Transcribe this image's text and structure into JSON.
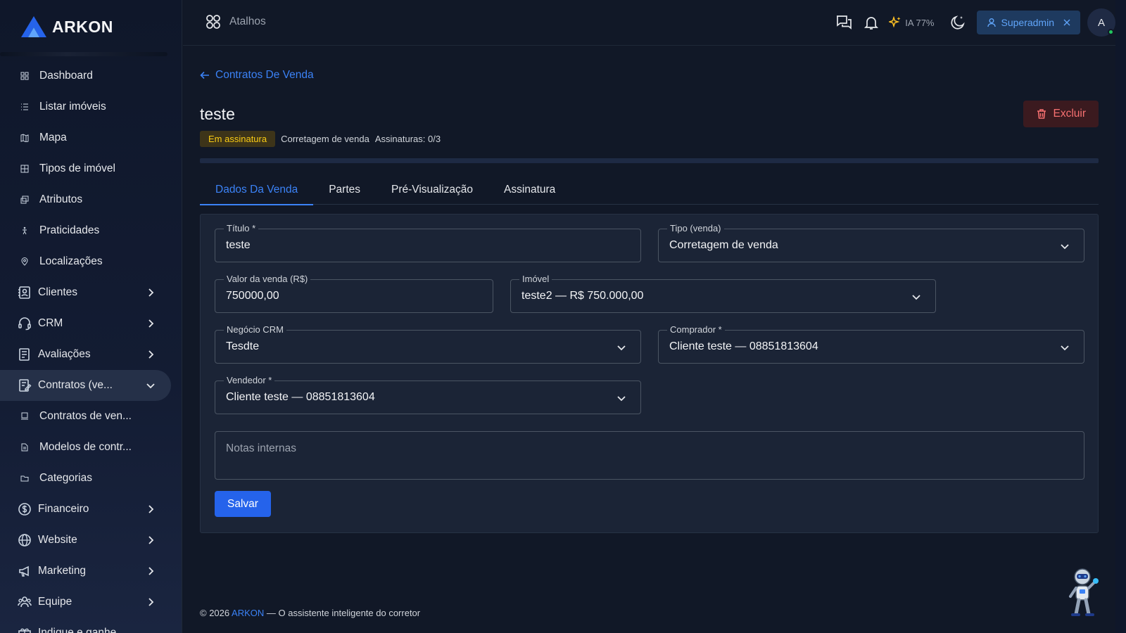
{
  "brand": {
    "name": "ARKON"
  },
  "sidebar": {
    "items": [
      {
        "label": "Dashboard",
        "icon": "dashboard-icon"
      },
      {
        "label": "Listar imóveis",
        "icon": "list-icon"
      },
      {
        "label": "Mapa",
        "icon": "map-icon"
      },
      {
        "label": "Tipos de imóvel",
        "icon": "grid-icon"
      },
      {
        "label": "Atributos",
        "icon": "attributes-icon"
      },
      {
        "label": "Praticidades",
        "icon": "accessibility-icon"
      },
      {
        "label": "Localizações",
        "icon": "location-pin-icon"
      },
      {
        "label": "Clientes",
        "icon": "contacts-icon"
      },
      {
        "label": "CRM",
        "icon": "headset-icon"
      },
      {
        "label": "Avaliações",
        "icon": "document-list-icon"
      },
      {
        "label": "Contratos (ve...",
        "icon": "contract-icon"
      },
      {
        "label": "Contratos de ven...",
        "icon": "monitor-icon"
      },
      {
        "label": "Modelos de contr...",
        "icon": "file-icon"
      },
      {
        "label": "Categorias",
        "icon": "folder-icon"
      },
      {
        "label": "Financeiro",
        "icon": "dollar-circle-icon"
      },
      {
        "label": "Website",
        "icon": "globe-icon"
      },
      {
        "label": "Marketing",
        "icon": "megaphone-icon"
      },
      {
        "label": "Equipe",
        "icon": "team-icon"
      },
      {
        "label": "Indique e ganhe",
        "icon": "gift-icon"
      }
    ]
  },
  "topbar": {
    "shortcuts_label": "Atalhos",
    "ia_label": "IA 77%",
    "role_label": "Superadmin",
    "avatar_initial": "A"
  },
  "main": {
    "back_label": "Contratos De Venda",
    "title": "teste",
    "delete_label": "Excluir",
    "status_badge": "Em assinatura",
    "contract_type": "Corretagem de venda",
    "signatures": "Assinaturas: 0/3",
    "tabs": [
      {
        "label": "Dados Da Venda"
      },
      {
        "label": "Partes"
      },
      {
        "label": "Pré-Visualização"
      },
      {
        "label": "Assinatura"
      }
    ],
    "form": {
      "titulo": {
        "label": "Título *",
        "value": "teste"
      },
      "tipo": {
        "label": "Tipo (venda)",
        "value": "Corretagem de venda"
      },
      "valor": {
        "label": "Valor da venda (R$)",
        "value": "750000,00"
      },
      "imovel": {
        "label": "Imóvel",
        "value": "teste2 — R$ 750.000,00"
      },
      "negocio": {
        "label": "Negócio CRM",
        "value": "Tesdte"
      },
      "comprador": {
        "label": "Comprador *",
        "value": "Cliente teste — 08851813604"
      },
      "vendedor": {
        "label": "Vendedor *",
        "value": "Cliente teste — 08851813604"
      },
      "notas": {
        "placeholder": "Notas internas"
      },
      "save_label": "Salvar"
    }
  },
  "footer": {
    "copyright": "© 2026",
    "brand": "ARKON",
    "tagline": "— O assistente inteligente do corretor"
  },
  "colors": {
    "accent": "#3b82f6",
    "danger": "#f87171",
    "warning": "#facc15",
    "background": "#111827"
  }
}
